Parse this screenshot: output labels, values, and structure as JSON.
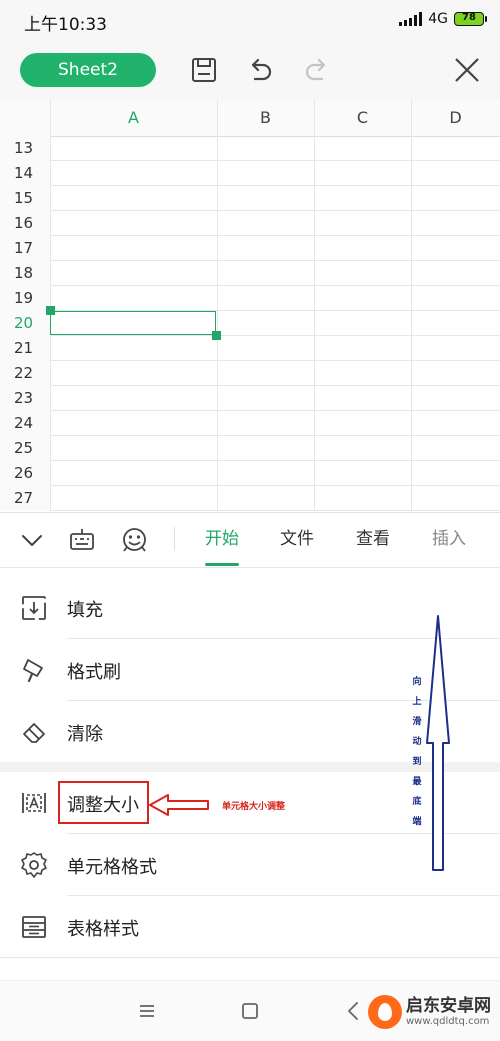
{
  "status_bar": {
    "time": "上午10:33",
    "network": "4G",
    "battery": "78"
  },
  "toolbar": {
    "sheet_label": "Sheet2"
  },
  "grid": {
    "columns": [
      "A",
      "B",
      "C",
      "D"
    ],
    "active_column": "A",
    "rows": [
      "13",
      "14",
      "15",
      "16",
      "17",
      "18",
      "19",
      "20",
      "21",
      "22",
      "23",
      "24",
      "25",
      "26",
      "27"
    ],
    "active_row": "20"
  },
  "panel": {
    "tabs": [
      "开始",
      "文件",
      "查看",
      "插入"
    ],
    "active_tab": "开始"
  },
  "menu": {
    "items": [
      {
        "label": "填充",
        "icon": "fill-icon"
      },
      {
        "label": "格式刷",
        "icon": "format-painter-icon"
      },
      {
        "label": "清除",
        "icon": "eraser-icon"
      },
      {
        "label": "调整大小",
        "icon": "resize-icon"
      },
      {
        "label": "单元格格式",
        "icon": "gear-icon"
      },
      {
        "label": "表格样式",
        "icon": "table-style-icon"
      }
    ]
  },
  "annotations": {
    "resize_note": "单元格大小调整",
    "scroll_note": [
      "向",
      "上",
      "滑",
      "动",
      "到",
      "最",
      "底",
      "端"
    ],
    "accent_red": "#d9231f",
    "accent_blue": "#1d2f8a"
  },
  "watermark": {
    "name": "启东安卓网",
    "url": "www.qdldtq.com"
  },
  "colors": {
    "brand_green": "#21b36b"
  }
}
